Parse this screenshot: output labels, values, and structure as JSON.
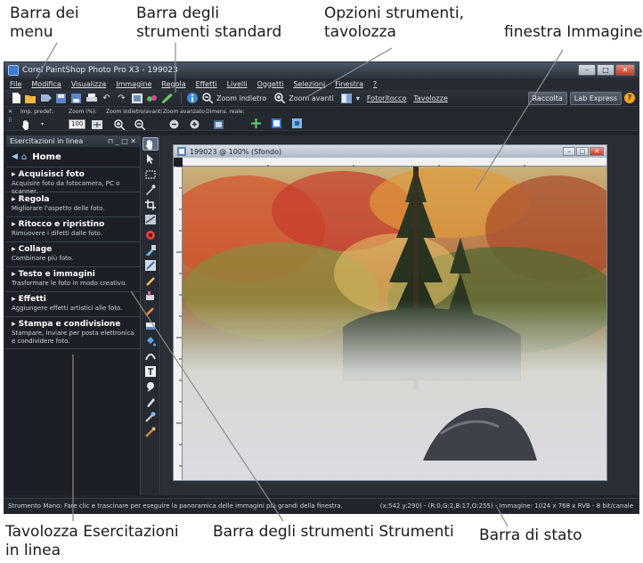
{
  "callouts": {
    "menu_bar": "Barra dei\nmenu",
    "standard_toolbar": "Barra degli\nstrumenti standard",
    "tool_options": "Opzioni strumenti,\ntavolozza",
    "image_window": "finestra Immagine",
    "learning_palette": "Tavolozza Esercitazioni\nin linea",
    "tools_toolbar": "Barra degli strumenti Strumenti",
    "status_bar": "Barra di stato"
  },
  "window": {
    "title": "Corel PaintShop Photo Pro X3 - 199023"
  },
  "menu": [
    "File",
    "Modifica",
    "Visualizza",
    "Immagine",
    "Regola",
    "Effetti",
    "Livelli",
    "Oggetti",
    "Selezioni",
    "Finestra",
    "?"
  ],
  "toolbar": {
    "zoom_out_label": "Zoom indietro",
    "zoom_in_label": "Zoom avanti",
    "retouch_label": "Fotoritocco",
    "palettes_label": "Tavolozze",
    "organizer_label": "Raccolta",
    "lab_express_label": "Lab Express"
  },
  "tool_options": {
    "presets_label": "Imp. predef.:",
    "zoom_pct_label": "Zoom (%):",
    "zoom_value": "100",
    "zoom_inout_label": "Zoom indietro/avanti",
    "zoom_more_label": "Zoom avanzato",
    "actual_size_label": "Dimens. reale:"
  },
  "learning_palette": {
    "title": "Esercitazioni in linea",
    "home": "Home",
    "sections": [
      {
        "title": "Acquisisci foto",
        "desc": "Acquisire foto da fotocamera, PC o scanner."
      },
      {
        "title": "Regola",
        "desc": "Migliorare l'aspetto delle foto."
      },
      {
        "title": "Ritocco e ripristino",
        "desc": "Rimuovere i difetti dalle foto."
      },
      {
        "title": "Collage",
        "desc": "Combinare più foto."
      },
      {
        "title": "Testo e immagini",
        "desc": "Trasformare le foto in modo creativo."
      },
      {
        "title": "Effetti",
        "desc": "Aggiungere effetti artistici alle foto."
      },
      {
        "title": "Stampa e condivisione",
        "desc": "Stampare, inviare per posta elettronica e condividere foto."
      }
    ]
  },
  "image_window": {
    "title": "199023 @ 100% (Sfondo)"
  },
  "status": {
    "message": "Strumento Mano: Fare clic e trascinare per eseguire la panoramica delle immagini più grandi della finestra.",
    "info": "(x:542 y:290) - (R:0,G:2,B:17,O:255) - Immagine: 1024 x 768 x RVB - 8 bit/canale"
  }
}
